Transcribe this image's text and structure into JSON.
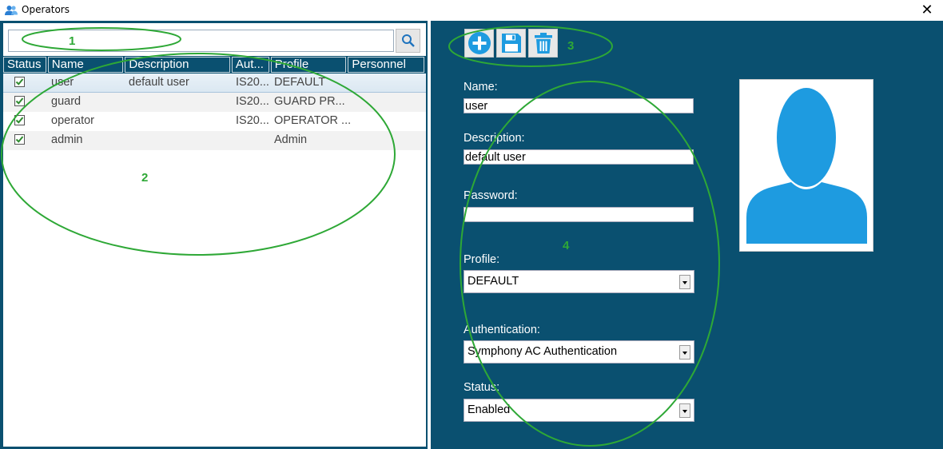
{
  "window": {
    "title": "Operators",
    "close_label": "✕"
  },
  "search": {
    "value": "",
    "placeholder": ""
  },
  "grid": {
    "columns": [
      "Status",
      "Name",
      "Description",
      "Aut...",
      "Profile",
      "Personnel"
    ],
    "rows": [
      {
        "checked": true,
        "name": "user",
        "description": "default user",
        "auth": "IS20...",
        "profile": "DEFAULT",
        "personnel": ""
      },
      {
        "checked": true,
        "name": "guard",
        "description": "",
        "auth": "IS20...",
        "profile": "GUARD PR...",
        "personnel": ""
      },
      {
        "checked": true,
        "name": "operator",
        "description": "",
        "auth": "IS20...",
        "profile": "OPERATOR ...",
        "personnel": ""
      },
      {
        "checked": true,
        "name": "admin",
        "description": "",
        "auth": "",
        "profile": "Admin",
        "personnel": ""
      }
    ]
  },
  "toolbar": {
    "add_icon": "add-circle-icon",
    "save_icon": "save-icon",
    "delete_icon": "trash-icon"
  },
  "form": {
    "name_label": "Name:",
    "name_value": "user",
    "description_label": "Description:",
    "description_value": "default user",
    "password_label": "Password:",
    "password_value": "",
    "profile_label": "Profile:",
    "profile_value": "DEFAULT",
    "auth_label": "Authentication:",
    "auth_value": "Symphony AC Authentication",
    "status_label": "Status:",
    "status_value": "Enabled"
  },
  "annotations": {
    "n1": "1",
    "n2": "2",
    "n3": "3",
    "n4": "4"
  },
  "colors": {
    "panel": "#0a5070",
    "accent": "#1e9be0",
    "annotation": "#2ea836"
  }
}
